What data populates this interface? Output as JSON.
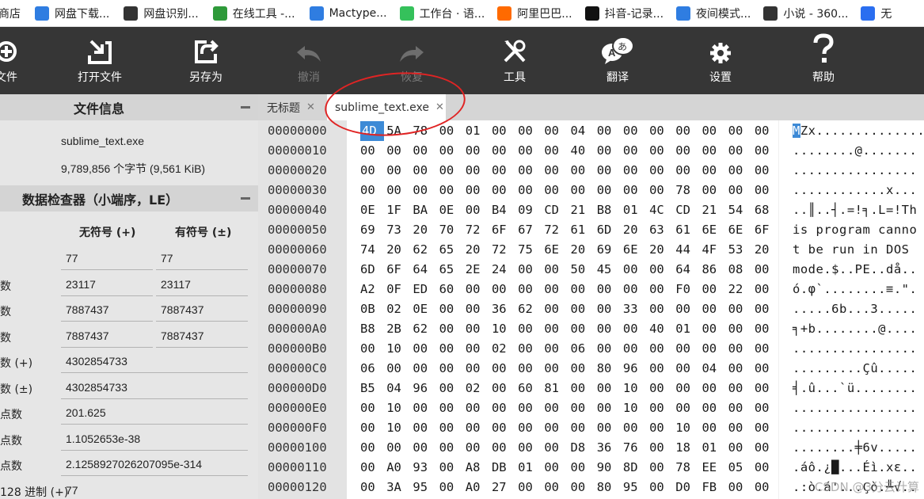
{
  "bookmarks": [
    {
      "label": "商店",
      "icon": "store-icon",
      "color": "#4caf50"
    },
    {
      "label": "网盘下载...",
      "icon": "cloud-icon",
      "color": "#2f7de1"
    },
    {
      "label": "网盘识别...",
      "icon": "panda-icon",
      "color": "#333333"
    },
    {
      "label": "在线工具 -...",
      "icon": "tool-t-icon",
      "color": "#2e9a3a"
    },
    {
      "label": "Mactype...",
      "icon": "cloud-icon",
      "color": "#2f7de1"
    },
    {
      "label": "工作台 · 语...",
      "icon": "leaf-icon",
      "color": "#35c15b"
    },
    {
      "label": "阿里巴巴...",
      "icon": "alibaba-icon",
      "color": "#ff6a00"
    },
    {
      "label": "抖音-记录...",
      "icon": "tiktok-icon",
      "color": "#111111"
    },
    {
      "label": "夜间模式...",
      "icon": "cloud-icon",
      "color": "#2f7de1"
    },
    {
      "label": "小说 - 360...",
      "icon": "novel-icon",
      "color": "#333333"
    },
    {
      "label": "无",
      "icon": "ring-icon",
      "color": "#2a6ef0"
    }
  ],
  "toolbar": {
    "items": [
      {
        "label": "文件",
        "icon": "new-file-icon",
        "enabled": true
      },
      {
        "label": "打开文件",
        "icon": "open-file-icon",
        "enabled": true
      },
      {
        "label": "另存为",
        "icon": "save-as-icon",
        "enabled": true
      },
      {
        "label": "撤消",
        "icon": "undo-icon",
        "enabled": false
      },
      {
        "label": "恢复",
        "icon": "redo-icon",
        "enabled": false
      },
      {
        "label": "工具",
        "icon": "tools-icon",
        "enabled": true
      },
      {
        "label": "翻译",
        "icon": "translate-icon",
        "enabled": true
      },
      {
        "label": "设置",
        "icon": "gear-icon",
        "enabled": true
      },
      {
        "label": "帮助",
        "icon": "help-icon",
        "enabled": true
      }
    ]
  },
  "file_info": {
    "title": "文件信息",
    "filename": "sublime_text.exe",
    "size": "9,789,856 个字节 (9,561 KiB)"
  },
  "inspector": {
    "title": "数据检查器（小端序，LE）",
    "col_unsigned": "无符号 (+)",
    "col_signed": "有符号 (±)",
    "rows": [
      {
        "label": "",
        "unsigned": "77",
        "signed": "77"
      },
      {
        "label": "数",
        "unsigned": "23117",
        "signed": "23117"
      },
      {
        "label": "数",
        "unsigned": "7887437",
        "signed": "7887437"
      },
      {
        "label": "数",
        "unsigned": "7887437",
        "signed": "7887437"
      },
      {
        "label": "数 (+)",
        "value": "4302854733"
      },
      {
        "label": "数 (±)",
        "value": "4302854733"
      },
      {
        "label": "点数",
        "value": "201.625"
      },
      {
        "label": "点数",
        "value": "1.1052653e-38"
      },
      {
        "label": "点数",
        "value": "2.1258927026207095e-314"
      },
      {
        "label": "128 进制 (+)",
        "value": "77"
      }
    ]
  },
  "tabs": [
    {
      "label": "无标题",
      "active": false
    },
    {
      "label": "sublime_text.exe",
      "active": true
    }
  ],
  "hex": {
    "rows": [
      {
        "offset": "00000000",
        "bytes": [
          "4D",
          "5A",
          "78",
          "00",
          "01",
          "00",
          "00",
          "00",
          "04",
          "00",
          "00",
          "00",
          "00",
          "00",
          "00",
          "00"
        ],
        "ascii_sel": "M",
        "ascii": "Zx.............."
      },
      {
        "offset": "00000010",
        "bytes": [
          "00",
          "00",
          "00",
          "00",
          "00",
          "00",
          "00",
          "00",
          "40",
          "00",
          "00",
          "00",
          "00",
          "00",
          "00",
          "00"
        ],
        "ascii": "........@......."
      },
      {
        "offset": "00000020",
        "bytes": [
          "00",
          "00",
          "00",
          "00",
          "00",
          "00",
          "00",
          "00",
          "00",
          "00",
          "00",
          "00",
          "00",
          "00",
          "00",
          "00"
        ],
        "ascii": "................"
      },
      {
        "offset": "00000030",
        "bytes": [
          "00",
          "00",
          "00",
          "00",
          "00",
          "00",
          "00",
          "00",
          "00",
          "00",
          "00",
          "00",
          "78",
          "00",
          "00",
          "00"
        ],
        "ascii": "............x..."
      },
      {
        "offset": "00000040",
        "bytes": [
          "0E",
          "1F",
          "BA",
          "0E",
          "00",
          "B4",
          "09",
          "CD",
          "21",
          "B8",
          "01",
          "4C",
          "CD",
          "21",
          "54",
          "68"
        ],
        "ascii": "..║..┤.=!╕.L=!Th"
      },
      {
        "offset": "00000050",
        "bytes": [
          "69",
          "73",
          "20",
          "70",
          "72",
          "6F",
          "67",
          "72",
          "61",
          "6D",
          "20",
          "63",
          "61",
          "6E",
          "6E",
          "6F"
        ],
        "ascii": "is program canno"
      },
      {
        "offset": "00000060",
        "bytes": [
          "74",
          "20",
          "62",
          "65",
          "20",
          "72",
          "75",
          "6E",
          "20",
          "69",
          "6E",
          "20",
          "44",
          "4F",
          "53",
          "20"
        ],
        "ascii": "t be run in DOS "
      },
      {
        "offset": "00000070",
        "bytes": [
          "6D",
          "6F",
          "64",
          "65",
          "2E",
          "24",
          "00",
          "00",
          "50",
          "45",
          "00",
          "00",
          "64",
          "86",
          "08",
          "00"
        ],
        "ascii": "mode.$..PE..då.."
      },
      {
        "offset": "00000080",
        "bytes": [
          "A2",
          "0F",
          "ED",
          "60",
          "00",
          "00",
          "00",
          "00",
          "00",
          "00",
          "00",
          "00",
          "F0",
          "00",
          "22",
          "00"
        ],
        "ascii": "ó.φ`........≡.\"."
      },
      {
        "offset": "00000090",
        "bytes": [
          "0B",
          "02",
          "0E",
          "00",
          "00",
          "36",
          "62",
          "00",
          "00",
          "00",
          "33",
          "00",
          "00",
          "00",
          "00",
          "00"
        ],
        "ascii": ".....6b...3....."
      },
      {
        "offset": "000000A0",
        "bytes": [
          "B8",
          "2B",
          "62",
          "00",
          "00",
          "10",
          "00",
          "00",
          "00",
          "00",
          "00",
          "40",
          "01",
          "00",
          "00",
          "00"
        ],
        "ascii": "╕+b........@...."
      },
      {
        "offset": "000000B0",
        "bytes": [
          "00",
          "10",
          "00",
          "00",
          "00",
          "02",
          "00",
          "00",
          "06",
          "00",
          "00",
          "00",
          "00",
          "00",
          "00",
          "00"
        ],
        "ascii": "................"
      },
      {
        "offset": "000000C0",
        "bytes": [
          "06",
          "00",
          "00",
          "00",
          "00",
          "00",
          "00",
          "00",
          "00",
          "80",
          "96",
          "00",
          "00",
          "04",
          "00",
          "00"
        ],
        "ascii": ".........Çû....."
      },
      {
        "offset": "000000D0",
        "bytes": [
          "B5",
          "04",
          "96",
          "00",
          "02",
          "00",
          "60",
          "81",
          "00",
          "00",
          "10",
          "00",
          "00",
          "00",
          "00",
          "00"
        ],
        "ascii": "╡.û...`ü........"
      },
      {
        "offset": "000000E0",
        "bytes": [
          "00",
          "10",
          "00",
          "00",
          "00",
          "00",
          "00",
          "00",
          "00",
          "00",
          "10",
          "00",
          "00",
          "00",
          "00",
          "00"
        ],
        "ascii": "................"
      },
      {
        "offset": "000000F0",
        "bytes": [
          "00",
          "10",
          "00",
          "00",
          "00",
          "00",
          "00",
          "00",
          "00",
          "00",
          "00",
          "00",
          "10",
          "00",
          "00",
          "00"
        ],
        "ascii": "................"
      },
      {
        "offset": "00000100",
        "bytes": [
          "00",
          "00",
          "00",
          "00",
          "00",
          "00",
          "00",
          "00",
          "D8",
          "36",
          "76",
          "00",
          "18",
          "01",
          "00",
          "00"
        ],
        "ascii": "........╪6v....."
      },
      {
        "offset": "00000110",
        "bytes": [
          "00",
          "A0",
          "93",
          "00",
          "A8",
          "DB",
          "01",
          "00",
          "00",
          "90",
          "8D",
          "00",
          "78",
          "EE",
          "05",
          "00"
        ],
        "ascii": ".áô.¿█...Éì.xε.."
      },
      {
        "offset": "00000120",
        "bytes": [
          "00",
          "3A",
          "95",
          "00",
          "A0",
          "27",
          "00",
          "00",
          "00",
          "80",
          "95",
          "00",
          "D0",
          "FB",
          "00",
          "00"
        ],
        "ascii": ".:ò.á'...Çò.╨√.."
      }
    ]
  },
  "watermark": "CSDN @3分云计算"
}
